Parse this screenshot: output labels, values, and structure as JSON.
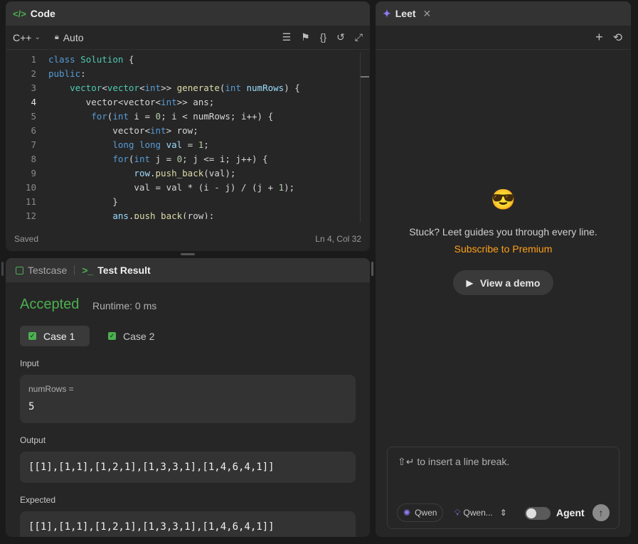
{
  "code_panel": {
    "title": "Code",
    "language": "C++",
    "mode": "Auto",
    "status": "Saved",
    "cursor": "Ln 4, Col 32",
    "current_line": 4
  },
  "code_lines": [
    {
      "n": "1",
      "html": "<span class=\"kw\">class</span> <span class=\"ty\">Solution</span> {"
    },
    {
      "n": "2",
      "html": "<span class=\"kw\">public</span>:"
    },
    {
      "n": "3",
      "html": "    <span class=\"ty\">vector</span>&lt;<span class=\"ty\">vector</span>&lt;<span class=\"kw\">int</span>&gt;&gt; <span class=\"fn\">generate</span>(<span class=\"kw\">int</span> <span class=\"var\">numRows</span>) {"
    },
    {
      "n": "4",
      "html": "       vector&lt;vector&lt;<span class=\"kw\">int</span>&gt;&gt; ans;"
    },
    {
      "n": "5",
      "html": "        <span class=\"kw\">for</span>(<span class=\"kw\">int</span> i = <span class=\"nm\">0</span>; i &lt; numRows; i++) {"
    },
    {
      "n": "6",
      "html": "            vector&lt;<span class=\"kw\">int</span>&gt; row;"
    },
    {
      "n": "7",
      "html": "            <span class=\"kw\">long long</span> <span class=\"var\">val</span> = <span class=\"nm\">1</span>;"
    },
    {
      "n": "8",
      "html": "            <span class=\"kw\">for</span>(<span class=\"kw\">int</span> j = <span class=\"nm\">0</span>; j &lt;= i; j++) {"
    },
    {
      "n": "9",
      "html": "                <span class=\"var\">row</span>.<span class=\"fn\">push_back</span>(val);"
    },
    {
      "n": "10",
      "html": "                val = val * (i - j) / (j + <span class=\"nm\">1</span>);"
    },
    {
      "n": "11",
      "html": "            }"
    },
    {
      "n": "12",
      "html": "            <span class=\"var\">ans</span>.<span class=\"fn\">push_back</span>(row);"
    }
  ],
  "test_panel": {
    "tab_testcase": "Testcase",
    "tab_result": "Test Result",
    "verdict": "Accepted",
    "runtime": "Runtime: 0 ms",
    "case1": "Case 1",
    "case2": "Case 2",
    "input_label": "Input",
    "input_var": "numRows =",
    "input_value": "5",
    "output_label": "Output",
    "output_value": "[[1],[1,1],[1,2,1],[1,3,3,1],[1,4,6,4,1]]",
    "expected_label": "Expected",
    "expected_value": "[[1],[1,1],[1,2,1],[1,3,3,1],[1,4,6,4,1]]"
  },
  "leet_panel": {
    "title": "Leet",
    "emoji": "😎",
    "prompt": "Stuck? Leet guides you through every line.",
    "subscribe": "Subscribe to Premium",
    "demo": "View a demo",
    "placeholder": "⇧↵ to insert a line break.",
    "model_provider": "Qwen",
    "model_name": "Qwen...",
    "agent_label": "Agent"
  },
  "colors": {
    "accent_green": "#4caf50",
    "premium_orange": "#ffa116",
    "leet_purple": "#8b7cf6"
  }
}
